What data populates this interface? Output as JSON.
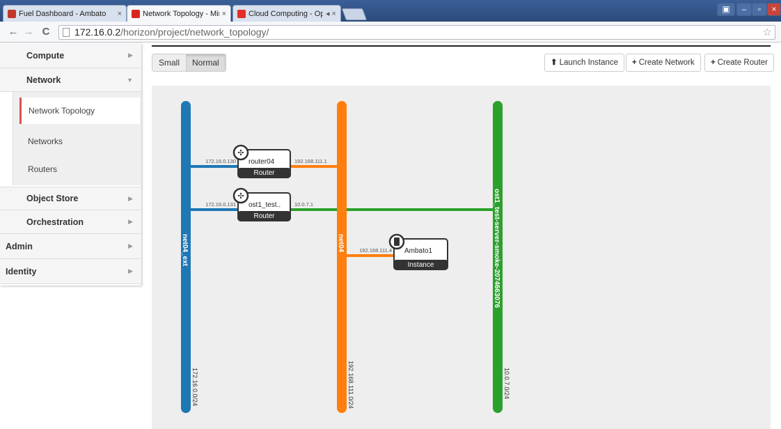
{
  "browser": {
    "tabs": [
      {
        "label": "Fuel Dashboard - Ambato",
        "close": "×",
        "color": "#c0392b"
      },
      {
        "label": "Network Topology - Miran",
        "close": "×",
        "color": "#d9261c",
        "active": true
      },
      {
        "label": "Cloud Computing - Op",
        "close": "◂ ×",
        "color": "#e52d27"
      }
    ],
    "url_host": "172.16.0.2",
    "url_path": "/horizon/project/network_topology/",
    "window_controls": [
      "▣",
      "–",
      "▫",
      "×"
    ]
  },
  "sidebar": {
    "sections": [
      {
        "label": "Compute",
        "chevron": "▶"
      },
      {
        "label": "Network",
        "chevron": "▼"
      },
      {
        "label": "Object Store",
        "chevron": "▶"
      },
      {
        "label": "Orchestration",
        "chevron": "▶"
      },
      {
        "label": "Admin",
        "chevron": "▶"
      },
      {
        "label": "Identity",
        "chevron": "▶"
      }
    ],
    "network_links": [
      {
        "label": "Network Topology",
        "active": true
      },
      {
        "label": "Networks"
      },
      {
        "label": "Routers"
      }
    ]
  },
  "toolbar": {
    "size_small": "Small",
    "size_normal": "Normal",
    "launch_instance": "Launch Instance",
    "create_network": "Create Network",
    "create_router": "Create Router",
    "launch_icon": "cloud-upload-icon",
    "plus_icon": "+"
  },
  "topology": {
    "networks": [
      {
        "name": "net04_ext",
        "cidr": "172.16.0.0/24",
        "color": "#1f77b4"
      },
      {
        "name": "net04",
        "cidr": "192.168.111.0/24",
        "color": "#ff7f0e"
      },
      {
        "name": "ost1_test-server-smoke-2074663076",
        "cidr": "10.0.7.0/24",
        "color": "#2ca02c"
      }
    ],
    "devices": [
      {
        "name": "router04",
        "type": "Router",
        "icon": "router-icon",
        "links": [
          {
            "ip": "172.16.0.130",
            "net": 0
          },
          {
            "ip": "192.168.111.1",
            "net": 1
          }
        ]
      },
      {
        "name": "ost1_test..",
        "type": "Router",
        "icon": "router-icon",
        "links": [
          {
            "ip": "172.16.0.131",
            "net": 0
          },
          {
            "ip": "10.0.7.1",
            "net": 2
          }
        ]
      },
      {
        "name": "Ambato1",
        "type": "Instance",
        "icon": "server-icon",
        "links": [
          {
            "ip": "192.168.111.4",
            "net": 1
          }
        ]
      }
    ]
  }
}
